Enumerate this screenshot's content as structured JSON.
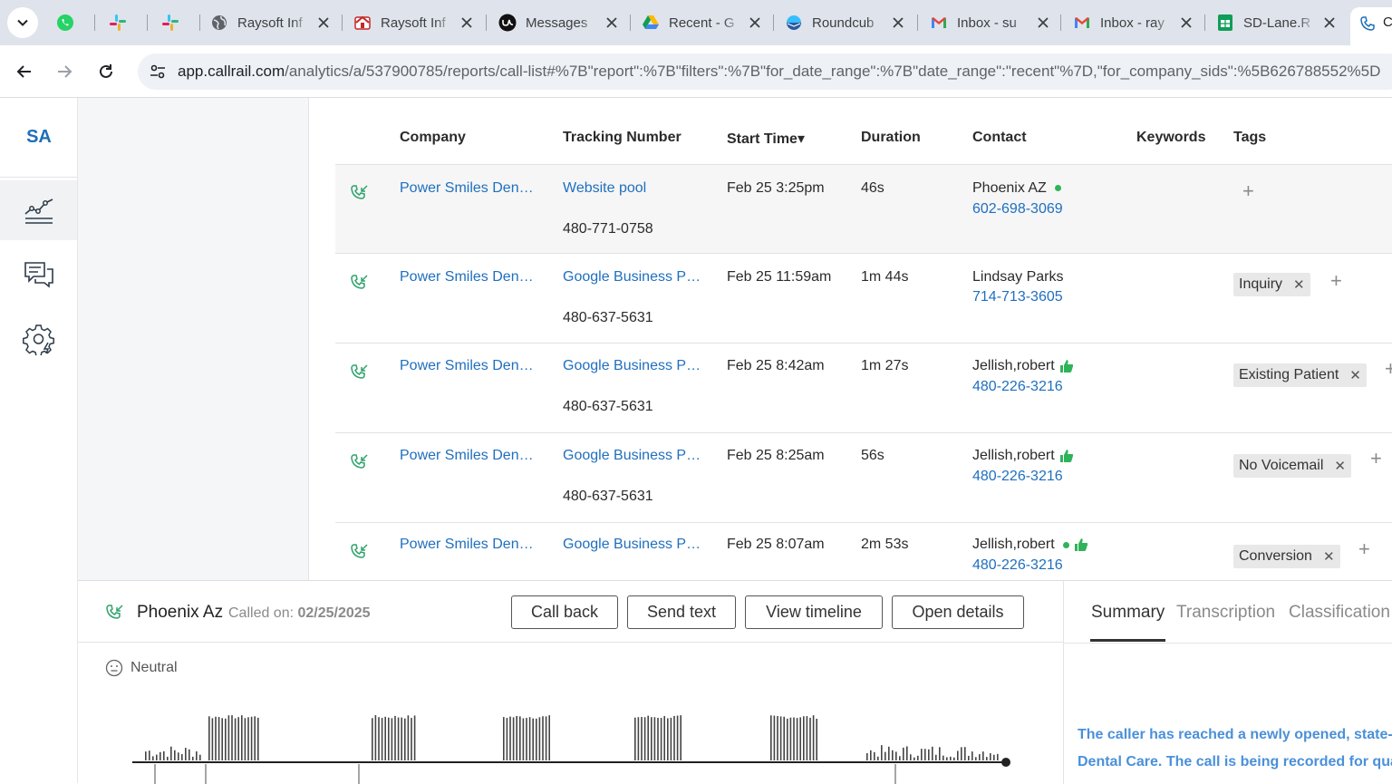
{
  "browser": {
    "tabs": [
      {
        "label": "",
        "icon": "whatsapp-icon"
      },
      {
        "label": "",
        "icon": "slack-icon"
      },
      {
        "label": "",
        "icon": "slack-icon"
      },
      {
        "label": "Raysoft Inf",
        "icon": "globe-icon"
      },
      {
        "label": "Raysoft Inf",
        "icon": "raysoft-icon"
      },
      {
        "label": "Messages",
        "icon": "upwork-icon"
      },
      {
        "label": "Recent - G",
        "icon": "google-drive-icon"
      },
      {
        "label": "Roundcub",
        "icon": "roundcube-icon"
      },
      {
        "label": "Inbox - su",
        "icon": "gmail-icon"
      },
      {
        "label": "Inbox - ray",
        "icon": "gmail-icon"
      },
      {
        "label": "SD-Lane.R",
        "icon": "google-sheets-icon"
      },
      {
        "label": "C",
        "icon": "callrail-icon"
      }
    ],
    "url_host": "app.callrail.com",
    "url_path": "/analytics/a/537900785/reports/call-list#%7B\"report\":%7B\"filters\":%7B\"for_date_range\":%7B\"date_range\":\"recent\"%7D,\"for_company_sids\":%5B626788552%5D"
  },
  "sidebar": {
    "logo": "SA",
    "items": [
      {
        "name": "analytics",
        "icon": "analytics-chart-icon"
      },
      {
        "name": "conversations",
        "icon": "chat-bubbles-icon"
      },
      {
        "name": "settings",
        "icon": "gear-icon"
      }
    ]
  },
  "table": {
    "columns": [
      "Company",
      "Tracking Number",
      "Start Time",
      "Duration",
      "Contact",
      "Keywords",
      "Tags"
    ],
    "sort_indicator": "▾",
    "rows": [
      {
        "company": "Power Smiles Den…",
        "source": "Website pool",
        "number": "480-771-0758",
        "start": "Feb 25 3:25pm",
        "duration": "46s",
        "contact_name": "Phoenix AZ",
        "contact_phone": "602-698-3069",
        "tags": [],
        "green_dot": true,
        "thumb": false
      },
      {
        "company": "Power Smiles Den…",
        "source": "Google Business P…",
        "number": "480-637-5631",
        "start": "Feb 25 11:59am",
        "duration": "1m 44s",
        "contact_name": "Lindsay Parks",
        "contact_phone": "714-713-3605",
        "tags": [
          "Inquiry"
        ],
        "green_dot": false,
        "thumb": false
      },
      {
        "company": "Power Smiles Den…",
        "source": "Google Business P…",
        "number": "480-637-5631",
        "start": "Feb 25 8:42am",
        "duration": "1m 27s",
        "contact_name": "Jellish,robert",
        "contact_phone": "480-226-3216",
        "tags": [
          "Existing Patient"
        ],
        "green_dot": false,
        "thumb": true
      },
      {
        "company": "Power Smiles Den…",
        "source": "Google Business P…",
        "number": "480-637-5631",
        "start": "Feb 25 8:25am",
        "duration": "56s",
        "contact_name": "Jellish,robert",
        "contact_phone": "480-226-3216",
        "tags": [
          "No Voicemail"
        ],
        "green_dot": false,
        "thumb": true
      },
      {
        "company": "Power Smiles Den…",
        "source": "Google Business P…",
        "number": "480-637-5631",
        "start": "Feb 25 8:07am",
        "duration": "2m 53s",
        "contact_name": "Jellish,robert",
        "contact_phone": "480-226-3216",
        "tags": [
          "Conversion"
        ],
        "green_dot": true,
        "thumb": true
      }
    ]
  },
  "detail": {
    "caller": "Phoenix Az",
    "called_on_label": "Called on:",
    "called_on_date": "02/25/2025",
    "buttons": {
      "call_back": "Call back",
      "send_text": "Send text",
      "view_timeline": "View timeline",
      "open_details": "Open details"
    },
    "sentiment": "Neutral",
    "tabs": {
      "summary": "Summary",
      "transcription": "Transcription",
      "classification": "Classification"
    },
    "summary_text": "The caller has reached a newly opened, state-of-the-art Dental Care. The call is being recorded for quality"
  },
  "colors": {
    "link": "#1f6fbf",
    "brand": "#1e6fb8",
    "green": "#2fb35a",
    "summary_text": "#4a90d9"
  }
}
